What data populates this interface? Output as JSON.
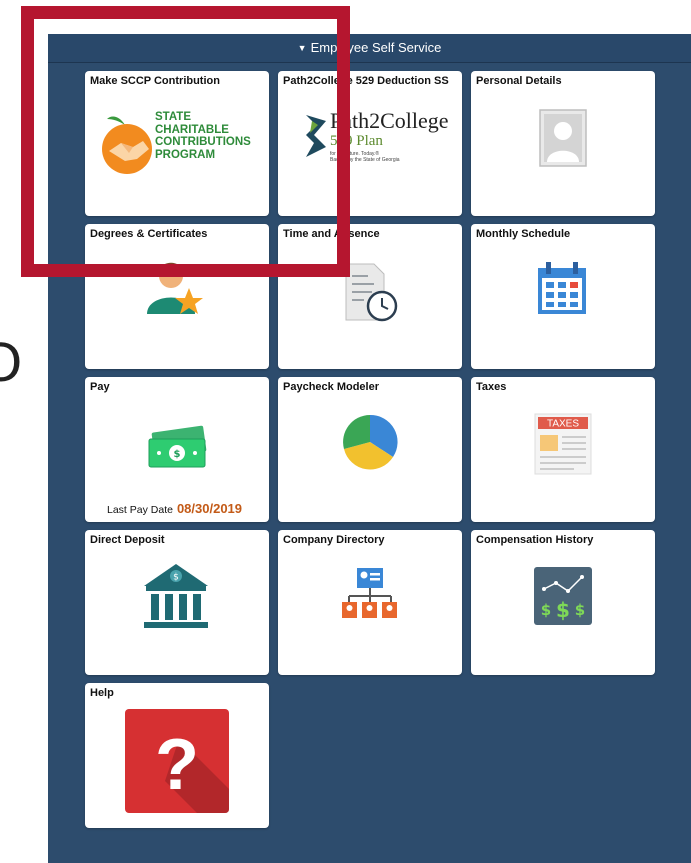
{
  "header": {
    "title": "Employee Self Service"
  },
  "tiles": [
    {
      "title": "Make SCCP Contribution",
      "logo_lines": [
        "STATE",
        "CHARITABLE",
        "CONTRIBUTIONS",
        "PROGRAM"
      ]
    },
    {
      "title": "Path2College 529 Deduction SS",
      "logo_main": "Path2College",
      "logo_plan": "529 Plan",
      "logo_tag1": "for the future. Today.®",
      "logo_tag2": "Backed by the State of Georgia"
    },
    {
      "title": "Personal Details"
    },
    {
      "title": "Degrees & Certificates"
    },
    {
      "title": "Time and Absence"
    },
    {
      "title": "Monthly Schedule"
    },
    {
      "title": "Pay",
      "last_pay_label": "Last Pay Date",
      "last_pay_value": "08/30/2019"
    },
    {
      "title": "Paycheck Modeler"
    },
    {
      "title": "Taxes",
      "icon_text": "TAXES"
    },
    {
      "title": "Direct Deposit"
    },
    {
      "title": "Company Directory"
    },
    {
      "title": "Compensation History"
    },
    {
      "title": "Help",
      "icon_text": "?"
    }
  ],
  "icons": {
    "sccp": "peach-handshake-icon",
    "p2c": "path2college-logo",
    "personal": "person-silhouette-icon",
    "degrees": "person-star-icon",
    "time": "document-clock-icon",
    "schedule": "calendar-icon",
    "pay": "money-bills-icon",
    "paycheck": "pie-chart-icon",
    "taxes": "tax-form-icon",
    "deposit": "bank-building-icon",
    "directory": "org-chart-icon",
    "comp": "salary-trend-icon",
    "help": "question-mark-icon"
  },
  "colors": {
    "panel": "#2d4c6d",
    "highlight": "#b5162f",
    "pay_date": "#c35a17",
    "help_red": "#d63032"
  }
}
